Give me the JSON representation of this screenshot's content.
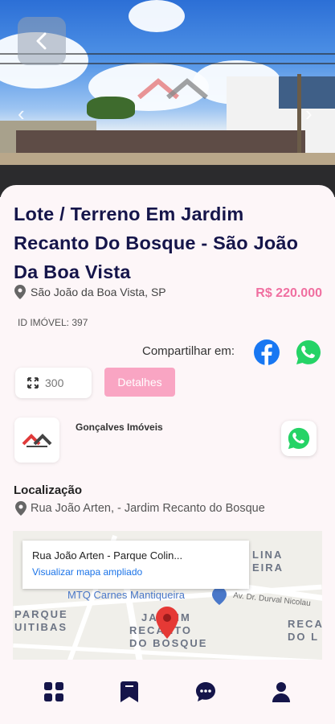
{
  "listing": {
    "title": "Lote / Terreno Em Jardim Recanto Do Bosque - São João Da Boa Vista",
    "city": "São João da Boa Vista, SP",
    "price": "R$ 220.000",
    "id_label": "ID IMÓVEL: 397",
    "area": "300",
    "details_button": "Detalhes",
    "share_label": "Compartilhar em:"
  },
  "agency": {
    "name": "Gonçalves Imóveis"
  },
  "location": {
    "heading": "Localização",
    "address": "Rua João Arten, - Jardim Recanto do Bosque"
  },
  "map": {
    "popup_title": "Rua João Arten - Parque Colin...",
    "popup_link": "Visualizar mapa ampliado",
    "labels": [
      "LINA",
      "EIRA",
      "MTQ Carnes Mantiqueira",
      "Av. Dr. Durval Nicolau",
      "PARQUE",
      "UITIBAS",
      "JARDIM",
      "RECANTO",
      "DO BOSQUE",
      "RECA",
      "DO L"
    ]
  },
  "colors": {
    "title": "#15154a",
    "price": "#f06fa0",
    "details_button": "#f9a5c3",
    "nav_icon": "#15154a",
    "whatsapp": "#25d366",
    "facebook": "#1877f2"
  },
  "icons": {
    "back": "chevron-left-icon",
    "location": "map-pin-icon",
    "area": "expand-icon",
    "facebook": "facebook-icon",
    "whatsapp": "whatsapp-icon",
    "nav": [
      "grid-icon",
      "bookmark-icon",
      "chat-icon",
      "user-icon"
    ]
  }
}
